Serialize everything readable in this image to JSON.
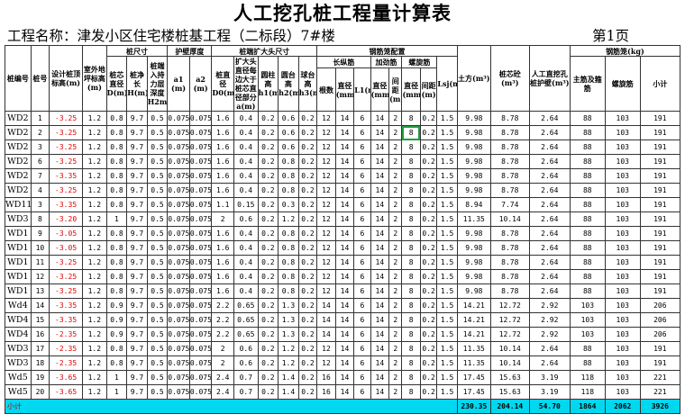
{
  "title": "人工挖孔桩工程量计算表",
  "project": "工程名称：津发小区住宅楼桩基工程（二标段）7#楼",
  "page": "第1页",
  "headers": {
    "pile_no": "桩编号",
    "serial": "桩号",
    "design_top": "设计桩顶标高(m)",
    "ground": "室外地坪标高(m)",
    "pile_size": "桩尺寸",
    "core_dia": "桩芯直径D(m)",
    "net_len": "桩净长H(m)",
    "rock_depth": "桩端入持力层深度H2m",
    "wall": "护壁厚度",
    "a1": "a1 (m)",
    "a2": "a2 (m)",
    "enlarge": "桩端扩大头尺寸",
    "d0": "桩直径D0(m)",
    "h_enlarge": "扩大头直径每边大于桩芯直径部分a(m)",
    "h1": "圆柱高h1(m)",
    "h2": "圆台高h2(m)",
    "h3": "球台高h3(m)",
    "rebar": "钢筋笼配置",
    "long": "长纵筋",
    "roots": "根数",
    "long_dia": "直径(mm)",
    "l1": "L1(m)",
    "stiff": "加劲筋",
    "stiff_dia": "直径(mm)",
    "stiff_gap": "间距(m)",
    "spiral": "螺旋筋",
    "spiral_dia": "直径(mm)",
    "spiral_gap": "间距(m)",
    "lsj": "Lsj(m)",
    "earth": "土方(m³)",
    "concrete": "桩芯砼(m³)",
    "wall_vol": "人工直挖孔桩护壁(m³)",
    "rebar_wt": "钢筋笼(kg)",
    "main_stiff": "主筋及箍筋",
    "spiral_wt": "螺旋筋",
    "subtotal": "小计"
  },
  "rows": [
    [
      "WD2",
      "1",
      "-3.25",
      "1.2",
      "0.8",
      "9.7",
      "0.5",
      "0.075",
      "0.075",
      "1.6",
      "0.4",
      "0.2",
      "0.6",
      "0.2",
      "12",
      "14",
      "6",
      "14",
      "2",
      "8",
      "0.2",
      "1.5",
      "9.98",
      "8.78",
      "2.64",
      "88",
      "103",
      "191"
    ],
    [
      "WD2",
      "2",
      "-3.25",
      "1.2",
      "0.8",
      "9.7",
      "0.5",
      "0.075",
      "0.075",
      "1.6",
      "0.4",
      "0.2",
      "0.6",
      "0.2",
      "12",
      "14",
      "6",
      "14",
      "2",
      "8",
      "0.2",
      "1.5",
      "9.98",
      "8.78",
      "2.64",
      "88",
      "103",
      "191"
    ],
    [
      "WD2",
      "3",
      "-3.25",
      "1.2",
      "0.8",
      "9.7",
      "0.5",
      "0.075",
      "0.075",
      "1.6",
      "0.4",
      "0.2",
      "0.6",
      "0.2",
      "12",
      "14",
      "6",
      "14",
      "2",
      "8",
      "0.2",
      "1.5",
      "9.98",
      "8.78",
      "2.64",
      "88",
      "103",
      "191"
    ],
    [
      "WD2",
      "6",
      "-3.25",
      "1.2",
      "0.8",
      "9.7",
      "0.5",
      "0.075",
      "0.075",
      "1.6",
      "0.4",
      "0.2",
      "0.8",
      "0.2",
      "12",
      "14",
      "6",
      "14",
      "2",
      "8",
      "0.2",
      "1.5",
      "9.98",
      "8.78",
      "2.64",
      "88",
      "103",
      "191"
    ],
    [
      "WD2",
      "7",
      "-3.35",
      "1.2",
      "0.8",
      "9.7",
      "0.5",
      "0.075",
      "0.075",
      "1.6",
      "0.4",
      "0.2",
      "0.8",
      "0.2",
      "12",
      "14",
      "6",
      "14",
      "2",
      "8",
      "0.2",
      "1.5",
      "9.98",
      "8.78",
      "2.64",
      "88",
      "103",
      "191"
    ],
    [
      "WD2",
      "4",
      "-3.25",
      "1.2",
      "0.8",
      "9.7",
      "0.5",
      "0.075",
      "0.075",
      "1.6",
      "0.4",
      "0.2",
      "0.8",
      "0.2",
      "12",
      "14",
      "6",
      "14",
      "2",
      "8",
      "0.2",
      "1.5",
      "9.98",
      "8.78",
      "2.64",
      "88",
      "103",
      "191"
    ],
    [
      "WD11",
      "3",
      "-3.35",
      "1.2",
      "0.8",
      "9.7",
      "0.5",
      "0.075",
      "0.075",
      "1.1",
      "0.15",
      "0.2",
      "0.3",
      "0.2",
      "12",
      "14",
      "6",
      "14",
      "2",
      "8",
      "0.2",
      "1.5",
      "8.94",
      "7.74",
      "2.64",
      "88",
      "103",
      "191"
    ],
    [
      "WD3",
      "8",
      "-3.20",
      "1.2",
      "1",
      "9.7",
      "0.5",
      "0.075",
      "0.075",
      "2",
      "0.6",
      "0.2",
      "1.2",
      "0.2",
      "12",
      "14",
      "6",
      "14",
      "2",
      "8",
      "0.2",
      "1.5",
      "11.35",
      "10.14",
      "2.64",
      "88",
      "103",
      "191"
    ],
    [
      "WD1",
      "9",
      "-3.05",
      "1.2",
      "0.8",
      "9.7",
      "0.5",
      "0.075",
      "0.075",
      "1.6",
      "0.4",
      "0.2",
      "0.8",
      "0.2",
      "12",
      "14",
      "6",
      "14",
      "2",
      "8",
      "0.2",
      "1.5",
      "9.98",
      "8.78",
      "2.64",
      "88",
      "103",
      "191"
    ],
    [
      "WD1",
      "10",
      "-3.05",
      "1.2",
      "0.8",
      "9.7",
      "0.5",
      "0.075",
      "0.075",
      "1.6",
      "0.4",
      "0.2",
      "0.8",
      "0.2",
      "12",
      "14",
      "6",
      "14",
      "2",
      "8",
      "0.2",
      "1.5",
      "9.98",
      "8.78",
      "2.64",
      "88",
      "103",
      "191"
    ],
    [
      "WD1",
      "11",
      "-3.25",
      "1.2",
      "0.8",
      "9.7",
      "0.5",
      "0.075",
      "0.075",
      "1.6",
      "0.4",
      "0.2",
      "0.8",
      "0.2",
      "12",
      "14",
      "6",
      "14",
      "2",
      "8",
      "0.2",
      "1.5",
      "9.98",
      "8.78",
      "2.64",
      "88",
      "103",
      "191"
    ],
    [
      "WD1",
      "12",
      "-3.25",
      "1.2",
      "0.8",
      "9.7",
      "0.5",
      "0.075",
      "0.075",
      "1.6",
      "0.4",
      "0.2",
      "0.8",
      "0.2",
      "12",
      "14",
      "6",
      "14",
      "2",
      "8",
      "0.2",
      "1.5",
      "9.98",
      "8.78",
      "2.64",
      "88",
      "103",
      "191"
    ],
    [
      "WD1",
      "13",
      "-3.25",
      "1.2",
      "0.8",
      "9.7",
      "0.5",
      "0.075",
      "0.075",
      "1.6",
      "0.4",
      "0.2",
      "0.8",
      "0.2",
      "12",
      "14",
      "6",
      "14",
      "2",
      "8",
      "0.2",
      "1.5",
      "9.98",
      "8.78",
      "2.64",
      "88",
      "103",
      "191"
    ],
    [
      "Wd4",
      "14",
      "-3.35",
      "1.2",
      "0.9",
      "9.7",
      "0.5",
      "0.075",
      "0.075",
      "2.2",
      "0.65",
      "0.2",
      "1.3",
      "0.2",
      "14",
      "14",
      "6",
      "14",
      "2",
      "8",
      "0.2",
      "1.5",
      "14.21",
      "12.72",
      "2.92",
      "103",
      "103",
      "206"
    ],
    [
      "WD4",
      "15",
      "-3.35",
      "1.2",
      "0.9",
      "9.7",
      "0.5",
      "0.075",
      "0.075",
      "2.2",
      "0.65",
      "0.2",
      "1.3",
      "0.2",
      "14",
      "14",
      "6",
      "14",
      "2",
      "8",
      "0.2",
      "1.5",
      "14.21",
      "12.72",
      "2.92",
      "103",
      "103",
      "206"
    ],
    [
      "WD4",
      "16",
      "-2.35",
      "1.2",
      "0.9",
      "9.7",
      "0.5",
      "0.075",
      "0.075",
      "2.2",
      "0.65",
      "0.2",
      "1.3",
      "0.2",
      "14",
      "14",
      "6",
      "14",
      "2",
      "8",
      "0.2",
      "1.5",
      "14.21",
      "12.72",
      "2.92",
      "103",
      "103",
      "206"
    ],
    [
      "WD3",
      "17",
      "-2.35",
      "1.2",
      "0.8",
      "9.7",
      "0.5",
      "0.075",
      "0.075",
      "2",
      "0.6",
      "0.2",
      "1.2",
      "0.2",
      "12",
      "14",
      "6",
      "14",
      "2",
      "8",
      "0.2",
      "1.5",
      "11.35",
      "10.14",
      "2.64",
      "88",
      "103",
      "191"
    ],
    [
      "WD3",
      "18",
      "-2.35",
      "1.2",
      "0.8",
      "9.7",
      "0.5",
      "0.075",
      "0.075",
      "2",
      "0.6",
      "0.2",
      "1.2",
      "0.2",
      "12",
      "14",
      "6",
      "14",
      "2",
      "8",
      "0.2",
      "1.5",
      "11.35",
      "10.14",
      "2.64",
      "88",
      "103",
      "191"
    ],
    [
      "Wd5",
      "19",
      "-3.65",
      "1.2",
      "1",
      "9.7",
      "0.5",
      "0.075",
      "0.075",
      "2.4",
      "0.7",
      "0.2",
      "1.4",
      "0.2",
      "16",
      "14",
      "6",
      "14",
      "2",
      "8",
      "0.2",
      "1.5",
      "17.45",
      "15.63",
      "3.19",
      "118",
      "103",
      "221"
    ],
    [
      "Wd5",
      "20",
      "-3.65",
      "1.2",
      "1",
      "9.7",
      "0.5",
      "0.075",
      "0.075",
      "2.4",
      "0.7",
      "0.2",
      "1.4",
      "0.2",
      "16",
      "14",
      "6",
      "14",
      "2",
      "8",
      "0.2",
      "1.5",
      "17.45",
      "15.63",
      "3.19",
      "118",
      "103",
      "221"
    ]
  ],
  "total": {
    "label": "小计",
    "earth": "230.35",
    "concrete": "204.14",
    "wall": "54.70",
    "main": "1864",
    "spiral": "2062",
    "sum": "3926"
  },
  "colors": {
    "total_fill": "#00d8f0",
    "negative": "#e00000",
    "selected": "#1f9f3f"
  }
}
